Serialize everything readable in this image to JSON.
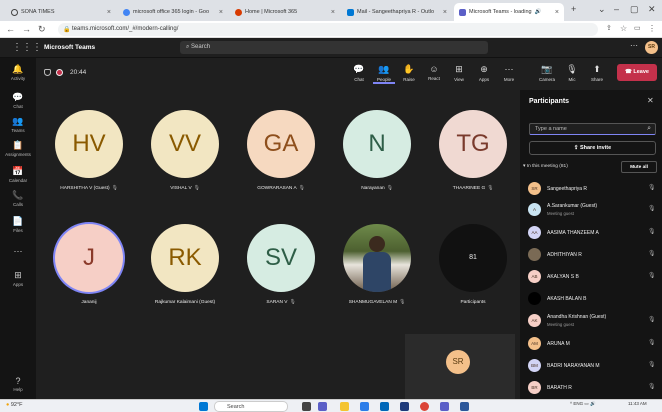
{
  "browser": {
    "tabs": [
      {
        "title": "SONA TIMES",
        "color": "#444"
      },
      {
        "title": "microsoft office 365 login - Goo",
        "color": "#4285f4"
      },
      {
        "title": "Home | Microsoft 365",
        "color": "#d83b01"
      },
      {
        "title": "Mail - Sangeethapriya R - Outlo",
        "color": "#0078d4"
      },
      {
        "title": "Microsoft Teams - loading",
        "color": "#5b5fc7"
      }
    ],
    "new_tab": "+",
    "url": "teams.microsoft.com/_#/modern-calling/"
  },
  "teams": {
    "app_title": "Microsoft Teams",
    "search_placeholder": "Search",
    "user_initials": "SR"
  },
  "rail": [
    {
      "label": "Activity",
      "icon": "bell-icon",
      "glyph": "🔔"
    },
    {
      "label": "Chat",
      "icon": "chat-icon",
      "glyph": "💬"
    },
    {
      "label": "Teams",
      "icon": "teams-icon",
      "glyph": "👥"
    },
    {
      "label": "Assignments",
      "icon": "assignments-icon",
      "glyph": "📋"
    },
    {
      "label": "Calendar",
      "icon": "calendar-icon",
      "glyph": "📅"
    },
    {
      "label": "Calls",
      "icon": "phone-icon",
      "glyph": "📞"
    },
    {
      "label": "Files",
      "icon": "file-icon",
      "glyph": "📄"
    },
    {
      "label": "",
      "icon": "more-icon",
      "glyph": "⋯"
    },
    {
      "label": "Apps",
      "icon": "apps-icon",
      "glyph": "⊞"
    },
    {
      "label": "Help",
      "icon": "help-icon",
      "glyph": "?"
    }
  ],
  "meeting": {
    "timer": "20:44",
    "toolbar": [
      {
        "label": "Chat",
        "icon": "chat-icon",
        "glyph": "💬"
      },
      {
        "label": "People",
        "icon": "people-icon",
        "glyph": "👥",
        "selected": true
      },
      {
        "label": "Raise",
        "icon": "hand-icon",
        "glyph": "✋"
      },
      {
        "label": "React",
        "icon": "smiley-icon",
        "glyph": "☺"
      },
      {
        "label": "View",
        "icon": "view-icon",
        "glyph": "⊞"
      },
      {
        "label": "Apps",
        "icon": "apps-icon",
        "glyph": "⊕"
      },
      {
        "label": "More",
        "icon": "more-icon",
        "glyph": "⋯"
      }
    ],
    "controls": [
      {
        "label": "Camera",
        "icon": "camera-icon",
        "glyph": "📷"
      },
      {
        "label": "Mic",
        "icon": "mic-off-icon",
        "glyph": "🎙"
      },
      {
        "label": "Share",
        "icon": "share-icon",
        "glyph": "⬆"
      }
    ],
    "leave_label": "Leave",
    "participants_tile": {
      "count": "81",
      "label": "Participants"
    },
    "self_initials": "SR",
    "tiles": [
      {
        "initials": "HV",
        "name": "HARSHITHA V (Guest)",
        "bg": "#f2e6c2",
        "fg": "#8a5a00"
      },
      {
        "initials": "VV",
        "name": "VISHAL V",
        "bg": "#f2e6c2",
        "fg": "#8a5a00"
      },
      {
        "initials": "GA",
        "name": "GOWRARASAN A",
        "bg": "#f6d9c0",
        "fg": "#8e4f1c"
      },
      {
        "initials": "N",
        "name": "Narayanan",
        "bg": "#d6ece2",
        "fg": "#2e5e47"
      },
      {
        "initials": "TG",
        "name": "THAARINEE G",
        "bg": "#f0d9d2",
        "fg": "#7a3a2c"
      },
      {
        "initials": "J",
        "name": "Jananij",
        "bg": "#f6cfc6",
        "fg": "#8b3a2a"
      },
      {
        "initials": "RK",
        "name": "Rajkumar Kalaimani (Guest)",
        "bg": "#f2e6c2",
        "fg": "#8a5a00"
      },
      {
        "initials": "SV",
        "name": "SARAN V",
        "bg": "#d6ece2",
        "fg": "#2e5e47"
      },
      {
        "initials": "",
        "name": "SHANMUGAVELAN M",
        "bg": "#5b6e3a",
        "fg": "#fff"
      }
    ]
  },
  "panel": {
    "title": "Participants",
    "search_placeholder": "Type a name",
    "share_invite": "Share invite",
    "in_meeting": "In this meeting (81)",
    "mute_all": "Mute all",
    "people": [
      {
        "initials": "SR",
        "name": "Sangeethapriya R",
        "sub": "",
        "bg": "#f4c08a"
      },
      {
        "initials": "A",
        "name": "A.Sarankumar (Guest)",
        "sub": "Meeting guest",
        "bg": "#c9e4f2"
      },
      {
        "initials": "AA",
        "name": "AASIMA THANZEEM A",
        "sub": "",
        "bg": "#d2d4f5"
      },
      {
        "initials": "",
        "name": "ADHITHIYAN R",
        "sub": "",
        "bg": "#7a6a55"
      },
      {
        "initials": "AB",
        "name": "AKALYAN S B",
        "sub": "",
        "bg": "#f6cfc6"
      },
      {
        "initials": "",
        "name": "AKASH BALAN B",
        "sub": "",
        "bg": "#000000"
      },
      {
        "initials": "AK",
        "name": "Anandha Krishnan (Guest)",
        "sub": "Meeting guest",
        "bg": "#f6cfc6"
      },
      {
        "initials": "AM",
        "name": "ARUNA M",
        "sub": "",
        "bg": "#f4c08a"
      },
      {
        "initials": "BM",
        "name": "BADRI NARAYANAN M",
        "sub": "",
        "bg": "#d2d4f5"
      },
      {
        "initials": "BR",
        "name": "BARATH R",
        "sub": "",
        "bg": "#f6cfc6"
      }
    ]
  },
  "taskbar": {
    "weather": "92°F",
    "search": "Search",
    "lang": "ENG",
    "time": "11:43 AM"
  }
}
